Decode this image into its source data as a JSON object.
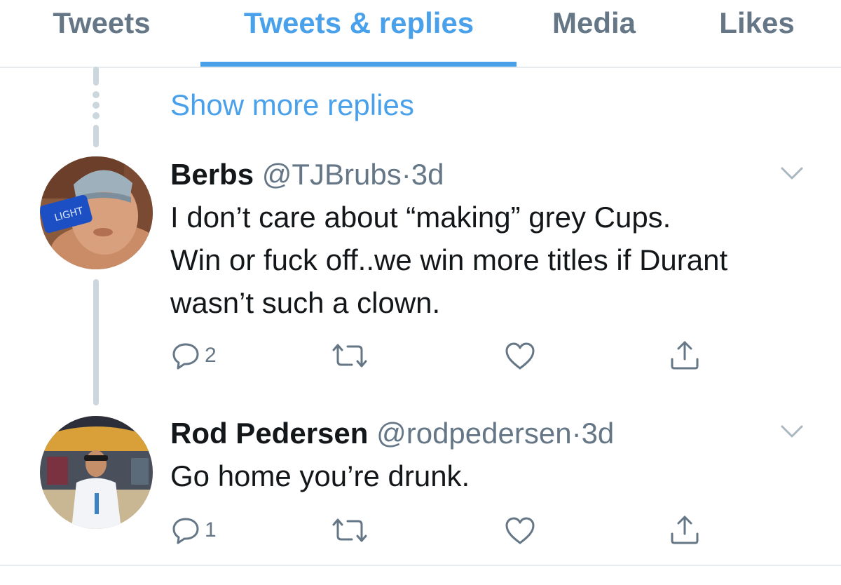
{
  "tabs": [
    {
      "label": "Tweets",
      "active": false
    },
    {
      "label": "Tweets & replies",
      "active": true
    },
    {
      "label": "Media",
      "active": false
    },
    {
      "label": "Likes",
      "active": false
    }
  ],
  "thread": {
    "show_more_label": "Show more replies"
  },
  "tweets": [
    {
      "display_name": "Berbs",
      "handle": "@TJBrubs",
      "separator": "·",
      "time": "3d",
      "text_lines": [
        "I don’t care about “making” grey Cups.",
        "Win or fuck off..we win more titles if Durant",
        "wasn’t such a clown."
      ],
      "reply_count": "2",
      "avatar_icon": "user-avatar-drinking-can"
    },
    {
      "display_name": "Rod Pedersen",
      "handle": "@rodpedersen",
      "separator": "·",
      "time": "3d",
      "text_lines": [
        "Go home you’re drunk."
      ],
      "reply_count": "1",
      "avatar_icon": "user-avatar-stadium"
    }
  ],
  "icons": {
    "reply": "reply-icon",
    "retweet": "retweet-icon",
    "like": "heart-icon",
    "share": "share-icon",
    "caret": "chevron-down-icon"
  },
  "colors": {
    "accent": "#4aa1eb",
    "muted": "#657786",
    "divider": "#e6ecf0",
    "thread": "#ccd6dd"
  }
}
